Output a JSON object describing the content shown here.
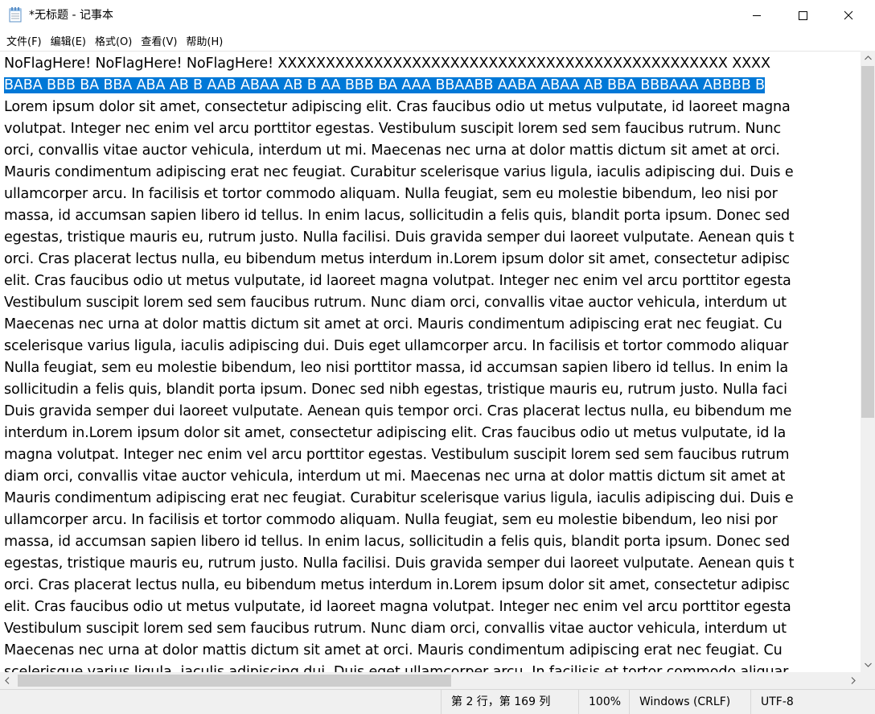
{
  "window": {
    "title": "*无标题 - 记事本"
  },
  "menu": [
    {
      "label": "文件(F)"
    },
    {
      "label": "编辑(E)"
    },
    {
      "label": "格式(O)"
    },
    {
      "label": "查看(V)"
    },
    {
      "label": "帮助(H)"
    }
  ],
  "editor": {
    "lines": [
      "NoFlagHere! NoFlagHere! NoFlagHere! XXXXXXXXXXXXXXXXXXXXXXXXXXXXXXXXXXXXXXXXXXXXXXX XXXX",
      "BABA BBB BA BBA ABA AB B AAB ABAA AB B AA BBB BA AAA BBAABB AABA ABAA AB BBA BBBAAA ABBBB B",
      "Lorem ipsum dolor sit amet, consectetur adipiscing elit. Cras faucibus odio ut metus vulputate, id laoreet magna",
      "volutpat. Integer nec enim vel arcu porttitor egestas. Vestibulum suscipit lorem sed sem faucibus rutrum. Nunc",
      "orci, convallis vitae auctor vehicula, interdum ut mi. Maecenas nec urna at dolor mattis dictum sit amet at orci.",
      "Mauris condimentum adipiscing erat nec feugiat. Curabitur scelerisque varius ligula, iaculis adipiscing dui. Duis e",
      "ullamcorper arcu. In facilisis et tortor commodo aliquam. Nulla feugiat, sem eu molestie bibendum, leo nisi por",
      "massa, id accumsan sapien libero id tellus. In enim lacus, sollicitudin a felis quis, blandit porta ipsum. Donec sed",
      "egestas, tristique mauris eu, rutrum justo. Nulla facilisi. Duis gravida semper dui laoreet vulputate. Aenean quis t",
      "orci. Cras placerat lectus nulla, eu bibendum metus interdum in.Lorem ipsum dolor sit amet, consectetur adipisc",
      "elit. Cras faucibus odio ut metus vulputate, id laoreet magna volutpat. Integer nec enim vel arcu porttitor egesta",
      "Vestibulum suscipit lorem sed sem faucibus rutrum. Nunc diam orci, convallis vitae auctor vehicula, interdum ut",
      "Maecenas nec urna at dolor mattis dictum sit amet at orci. Mauris condimentum adipiscing erat nec feugiat. Cu",
      "scelerisque varius ligula, iaculis adipiscing dui. Duis eget ullamcorper arcu. In facilisis et tortor commodo aliquar",
      "Nulla feugiat, sem eu molestie bibendum, leo nisi porttitor massa, id accumsan sapien libero id tellus. In enim la",
      "sollicitudin a felis quis, blandit porta ipsum. Donec sed nibh egestas, tristique mauris eu, rutrum justo. Nulla faci",
      "Duis gravida semper dui laoreet vulputate. Aenean quis tempor orci. Cras placerat lectus nulla, eu bibendum me",
      "interdum in.Lorem ipsum dolor sit amet, consectetur adipiscing elit. Cras faucibus odio ut metus vulputate, id la",
      "magna volutpat. Integer nec enim vel arcu porttitor egestas. Vestibulum suscipit lorem sed sem faucibus rutrum",
      "diam orci, convallis vitae auctor vehicula, interdum ut mi. Maecenas nec urna at dolor mattis dictum sit amet at",
      "Mauris condimentum adipiscing erat nec feugiat. Curabitur scelerisque varius ligula, iaculis adipiscing dui. Duis e",
      "ullamcorper arcu. In facilisis et tortor commodo aliquam. Nulla feugiat, sem eu molestie bibendum, leo nisi por",
      "massa, id accumsan sapien libero id tellus. In enim lacus, sollicitudin a felis quis, blandit porta ipsum. Donec sed",
      "egestas, tristique mauris eu, rutrum justo. Nulla facilisi. Duis gravida semper dui laoreet vulputate. Aenean quis t",
      "orci. Cras placerat lectus nulla, eu bibendum metus interdum in.Lorem ipsum dolor sit amet, consectetur adipisc",
      "elit. Cras faucibus odio ut metus vulputate, id laoreet magna volutpat. Integer nec enim vel arcu porttitor egesta",
      "Vestibulum suscipit lorem sed sem faucibus rutrum. Nunc diam orci, convallis vitae auctor vehicula, interdum ut",
      "Maecenas nec urna at dolor mattis dictum sit amet at orci. Mauris condimentum adipiscing erat nec feugiat. Cu",
      "scelerisque varius ligula, iaculis adipiscing dui. Duis eget ullamcorper arcu. In facilisis et tortor commodo aliquar"
    ],
    "selected_line_index": 1,
    "selection_color": "#0078d7"
  },
  "status": {
    "position": "第 2 行，第 169 列",
    "zoom": "100%",
    "line_ending": "Windows (CRLF)",
    "encoding": "UTF-8"
  }
}
